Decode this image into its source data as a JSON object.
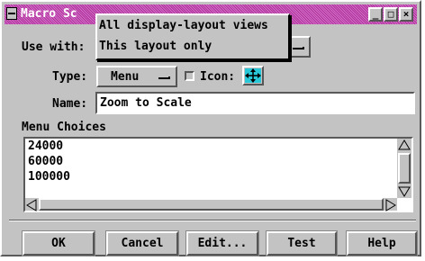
{
  "window": {
    "title": "Macro Sc"
  },
  "titlebar_buttons": [
    "_",
    "□",
    "×"
  ],
  "form": {
    "use_with_label": "Use with:",
    "type_label": "Type:",
    "type_value": "Menu",
    "icon_label": "Icon:",
    "name_label": "Name:",
    "name_value": "Zoom to Scale",
    "menu_choices_label": "Menu Choices"
  },
  "menu_choices": [
    "24000",
    "60000",
    "100000"
  ],
  "popup": {
    "items": [
      "All display-layout views",
      "This layout only"
    ],
    "selected": "This layout only"
  },
  "buttons": {
    "ok": "OK",
    "cancel": "Cancel",
    "edit": "Edit...",
    "test": "Test",
    "help": "Help"
  },
  "colors": {
    "title_bar": "#b0309a",
    "face": "#c3c3c3",
    "icon_accent": "#28c8d8"
  }
}
